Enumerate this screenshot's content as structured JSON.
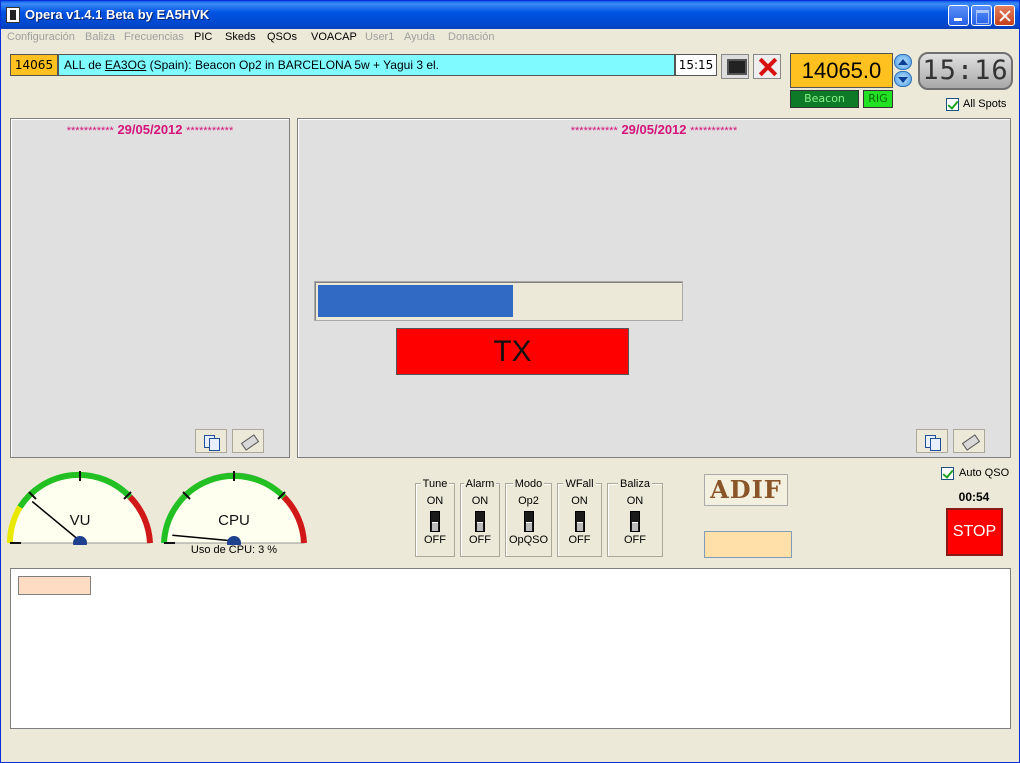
{
  "window": {
    "title": "Opera v1.4.1 Beta    by EA5HVK"
  },
  "menu": [
    {
      "label": "Configuración",
      "enabled": false
    },
    {
      "label": "Baliza",
      "enabled": false
    },
    {
      "label": "Frecuencias",
      "enabled": false
    },
    {
      "label": "PIC",
      "enabled": true
    },
    {
      "label": "Skeds",
      "enabled": true
    },
    {
      "label": "QSOs",
      "enabled": true
    },
    {
      "label": "VOACAP",
      "enabled": true
    },
    {
      "label": "User1",
      "enabled": false
    },
    {
      "label": "Ayuda",
      "enabled": false
    },
    {
      "label": "Donación",
      "enabled": false
    }
  ],
  "spot": {
    "freq": "14065",
    "prefix": "ALL de ",
    "call": "EA3OG",
    "text": " (Spain): Beacon Op2 in BARCELONA 5w + Yagui 3 el.",
    "time": "15:15"
  },
  "radio": {
    "frequency": "14065.0",
    "clock": "15:16",
    "beacon_label": "Beacon",
    "rig_label": "RIG",
    "all_spots_label": "All Spots",
    "all_spots_checked": true
  },
  "panels": {
    "left": {
      "stars_left": "***********",
      "date": "29/05/2012",
      "stars_right": "***********"
    },
    "right": {
      "stars_left": "***********",
      "date": "29/05/2012",
      "stars_right": "***********"
    }
  },
  "tx": {
    "label": "TX",
    "progress": 0.54
  },
  "gauges": {
    "vu": {
      "label": "VU",
      "level": 0.22
    },
    "cpu": {
      "label": "CPU",
      "level": 0.03,
      "usage_text": "Uso de CPU: 3 %"
    }
  },
  "switches": [
    {
      "title": "Tune",
      "on": "ON",
      "off": "OFF"
    },
    {
      "title": "Alarm",
      "on": "ON",
      "off": "OFF"
    },
    {
      "title": "Modo",
      "on": "Op2",
      "off": "OpQSO"
    },
    {
      "title": "WFall",
      "on": "ON",
      "off": "OFF"
    },
    {
      "title": "Baliza",
      "on": "ON",
      "off": "OFF"
    }
  ],
  "adif": {
    "label": "ADIF"
  },
  "auto_qso": {
    "label": "Auto QSO",
    "checked": true,
    "timer": "00:54"
  },
  "stop": {
    "label": "STOP"
  },
  "colors": {
    "spot_bg": "#7ffbff",
    "freq_bg": "#ffc11f",
    "date_color": "#d4147a",
    "tx_bg": "#ff0000",
    "progress": "#316ac5"
  }
}
